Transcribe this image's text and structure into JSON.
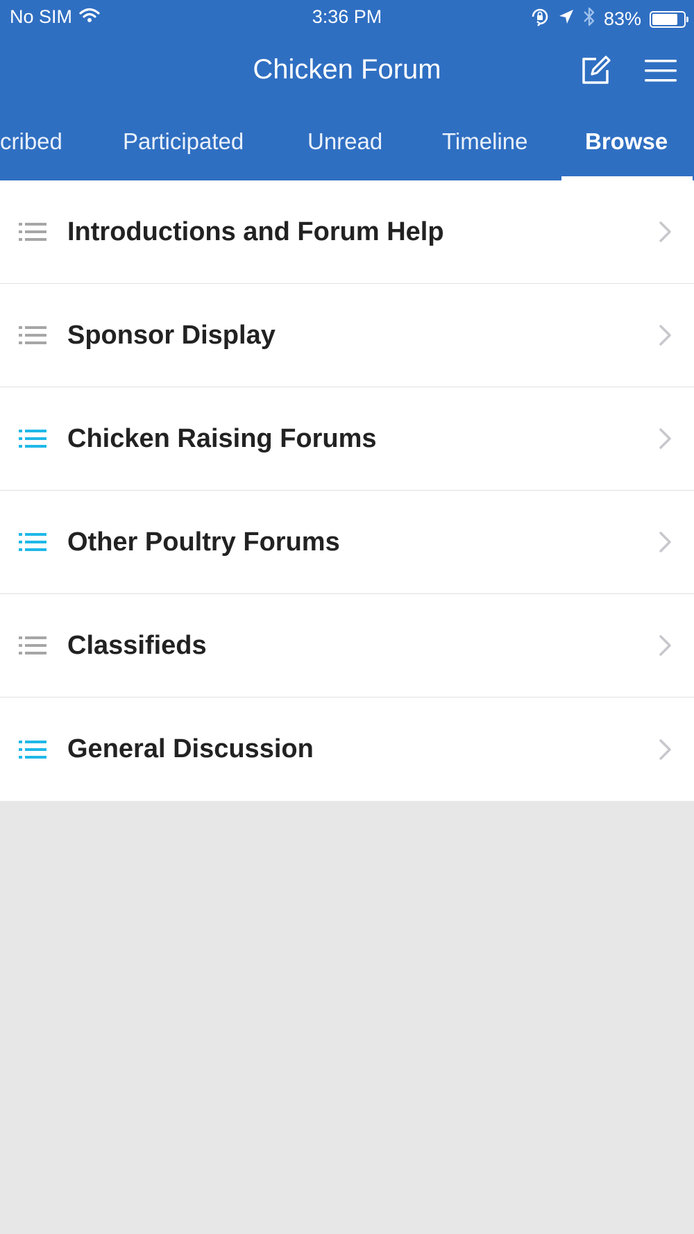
{
  "status_bar": {
    "carrier": "No SIM",
    "time": "3:36 PM",
    "battery_percent": "83%",
    "battery_level": 0.83
  },
  "header": {
    "title": "Chicken Forum"
  },
  "tabs": [
    {
      "label": "cribed",
      "active": false
    },
    {
      "label": "Participated",
      "active": false
    },
    {
      "label": "Unread",
      "active": false
    },
    {
      "label": "Timeline",
      "active": false
    },
    {
      "label": "Browse",
      "active": true
    }
  ],
  "forums": [
    {
      "label": "Introductions and Forum Help",
      "icon": "list-icon",
      "icon_color": "#a6a6a6"
    },
    {
      "label": "Sponsor Display",
      "icon": "list-icon",
      "icon_color": "#a6a6a6"
    },
    {
      "label": "Chicken Raising Forums",
      "icon": "list-icon",
      "icon_color": "#1fb8e8"
    },
    {
      "label": "Other Poultry Forums",
      "icon": "list-icon",
      "icon_color": "#1fb8e8"
    },
    {
      "label": "Classifieds",
      "icon": "list-icon",
      "icon_color": "#a6a6a6"
    },
    {
      "label": "General Discussion",
      "icon": "list-icon",
      "icon_color": "#1fb8e8"
    }
  ],
  "colors": {
    "header_bg": "#2f6fc2",
    "page_bg": "#e7e7e8",
    "chevron": "#c7c7cc"
  }
}
